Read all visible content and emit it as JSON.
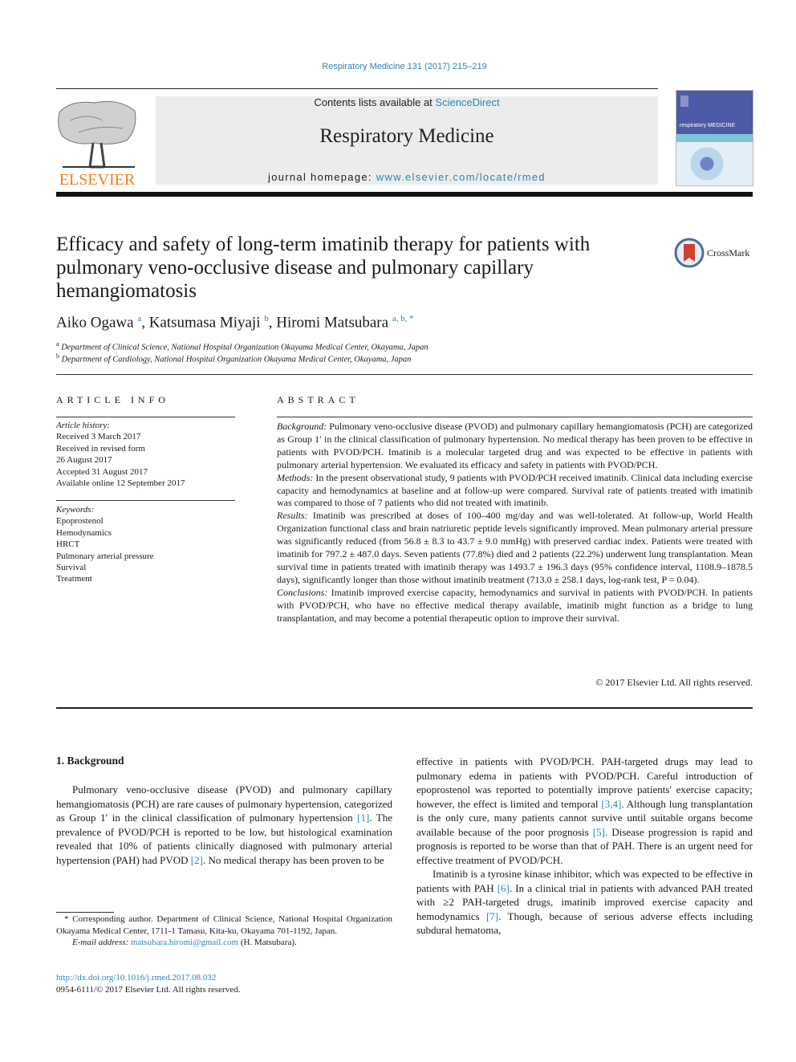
{
  "header": {
    "journal_ref": "Respiratory Medicine 131 (2017) 215–219",
    "contents_prefix": "Contents lists available at ",
    "contents_link": "ScienceDirect",
    "journal_name": "Respiratory Medicine",
    "homepage_prefix": "journal homepage: ",
    "homepage_link": "www.elsevier.com/locate/rmed",
    "publisher_logo_text": "ELSEVIER",
    "cover_title": "respiratory MEDICINE",
    "crossmark_label": "CrossMark",
    "colors": {
      "link": "#2a86b8",
      "elsevier": "#f07d1e",
      "banner": "#ececec",
      "cover": "#4d5aa5"
    }
  },
  "article": {
    "title": "Efficacy and safety of long-term imatinib therapy for patients with pulmonary veno-occlusive disease and pulmonary capillary hemangiomatosis",
    "authors": [
      {
        "name": "Aiko Ogawa",
        "sup": "a"
      },
      {
        "name": "Katsumasa Miyaji",
        "sup": "b"
      },
      {
        "name": "Hiromi Matsubara",
        "sup": "a, b, *"
      }
    ],
    "affiliations": [
      {
        "mark": "a",
        "text": "Department of Clinical Science, National Hospital Organization Okayama Medical Center, Okayama, Japan"
      },
      {
        "mark": "b",
        "text": "Department of Cardiology, National Hospital Organization Okayama Medical Center, Okayama, Japan"
      }
    ]
  },
  "article_info": {
    "heading": "ARTICLE INFO",
    "history_label": "Article history:",
    "history": [
      "Received 3 March 2017",
      "Received in revised form",
      "26 August 2017",
      "Accepted 31 August 2017",
      "Available online 12 September 2017"
    ],
    "keywords_label": "Keywords:",
    "keywords": [
      "Epoprostenol",
      "Hemodynamics",
      "HRCT",
      "Pulmonary arterial pressure",
      "Survival",
      "Treatment"
    ]
  },
  "abstract": {
    "heading": "ABSTRACT",
    "sections": [
      {
        "label": "Background:",
        "text": " Pulmonary veno-occlusive disease (PVOD) and pulmonary capillary hemangiomatosis (PCH) are categorized as Group 1′ in the clinical classification of pulmonary hypertension. No medical therapy has been proven to be effective in patients with PVOD/PCH. Imatinib is a molecular targeted drug and was expected to be effective in patients with pulmonary arterial hypertension. We evaluated its efficacy and safety in patients with PVOD/PCH."
      },
      {
        "label": "Methods:",
        "text": " In the present observational study, 9 patients with PVOD/PCH received imatinib. Clinical data including exercise capacity and hemodynamics at baseline and at follow-up were compared. Survival rate of patients treated with imatinib was compared to those of 7 patients who did not treated with imatinib."
      },
      {
        "label": "Results:",
        "text": " Imatinib was prescribed at doses of 100–400 mg/day and was well-tolerated. At follow-up, World Health Organization functional class and brain natriuretic peptide levels significantly improved. Mean pulmonary arterial pressure was significantly reduced (from 56.8 ± 8.3 to 43.7 ± 9.0 mmHg) with preserved cardiac index. Patients were treated with imatinib for 797.2 ± 487.0 days. Seven patients (77.8%) died and 2 patients (22.2%) underwent lung transplantation. Mean survival time in patients treated with imatinib therapy was 1493.7 ± 196.3 days (95% confidence interval, 1108.9–1878.5 days), significantly longer than those without imatinib treatment (713.0 ± 258.1 days, log-rank test, P = 0.04)."
      },
      {
        "label": "Conclusions:",
        "text": " Imatinib improved exercise capacity, hemodynamics and survival in patients with PVOD/PCH. In patients with PVOD/PCH, who have no effective medical therapy available, imatinib might function as a bridge to lung transplantation, and may become a potential therapeutic option to improve their survival."
      }
    ],
    "copyright": "© 2017 Elsevier Ltd. All rights reserved."
  },
  "body": {
    "section_heading": "1.  Background",
    "left_paragraph": {
      "parts": [
        "Pulmonary veno-occlusive disease (PVOD) and pulmonary capillary hemangiomatosis (PCH) are rare causes of pulmonary hypertension, categorized as Group 1′ in the clinical classification of pulmonary hypertension ",
        "[1]",
        ". The prevalence of PVOD/PCH is reported to be low, but histological examination revealed that 10% of patients clinically diagnosed with pulmonary arterial hypertension (PAH) had PVOD ",
        "[2]",
        ". No medical therapy has been proven to be"
      ]
    },
    "right_paragraph_1": {
      "parts": [
        "effective in patients with PVOD/PCH. PAH-targeted drugs may lead to pulmonary edema in patients with PVOD/PCH. Careful introduction of epoprostenol was reported to potentially improve patients' exercise capacity; however, the effect is limited and temporal ",
        "[3,4]",
        ". Although lung transplantation is the only cure, many patients cannot survive until suitable organs become available because of the poor prognosis ",
        "[5]",
        ". Disease progression is rapid and prognosis is reported to be worse than that of PAH. There is an urgent need for effective treatment of PVOD/PCH."
      ]
    },
    "right_paragraph_2": {
      "parts": [
        "Imatinib is a tyrosine kinase inhibitor, which was expected to be effective in patients with PAH ",
        "[6]",
        ". In a clinical trial in patients with advanced PAH treated with ≥2 PAH-targeted drugs, imatinib improved exercise capacity and hemodynamics ",
        "[7]",
        ". Though, because of serious adverse effects including subdural hematoma,"
      ]
    }
  },
  "footnote": {
    "corresponding": "* Corresponding author. Department of Clinical Science, National Hospital Organization Okayama Medical Center, 1711-1 Tamasu, Kita-ku, Okayama 701-1192, Japan.",
    "email_label": "E-mail address:",
    "email": "matsubara.hiromi@gmail.com",
    "email_suffix": " (H. Matsubara).",
    "doi": "http://dx.doi.org/10.1016/j.rmed.2017.08.032",
    "issn_line": "0954-6111/© 2017 Elsevier Ltd. All rights reserved."
  }
}
